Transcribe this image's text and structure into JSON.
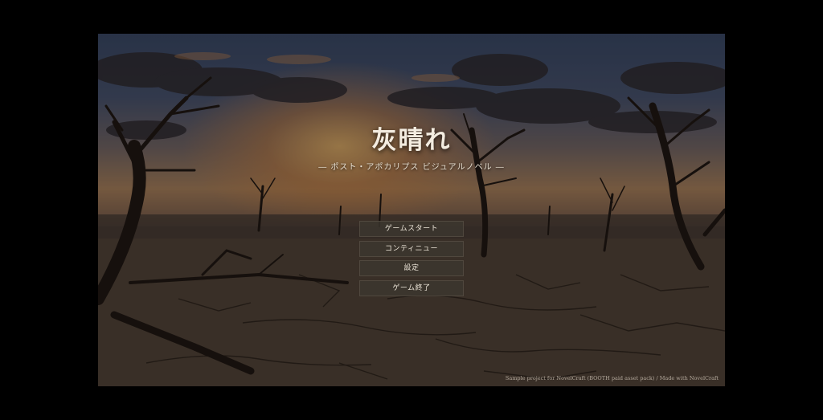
{
  "title": "灰晴れ",
  "subtitle": "― ポスト・アポカリプス ビジュアルノベル ―",
  "menu": {
    "items": [
      {
        "label": "ゲームスタート"
      },
      {
        "label": "コンティニュー"
      },
      {
        "label": "設定"
      },
      {
        "label": "ゲーム終了"
      }
    ]
  },
  "credit": "Sample project for NovelCraft (BOOTH paid asset pack) / Made with NovelCraft",
  "colors": {
    "background": "#000000",
    "button_bg": "#3c3730",
    "text": "#ece5d8"
  }
}
